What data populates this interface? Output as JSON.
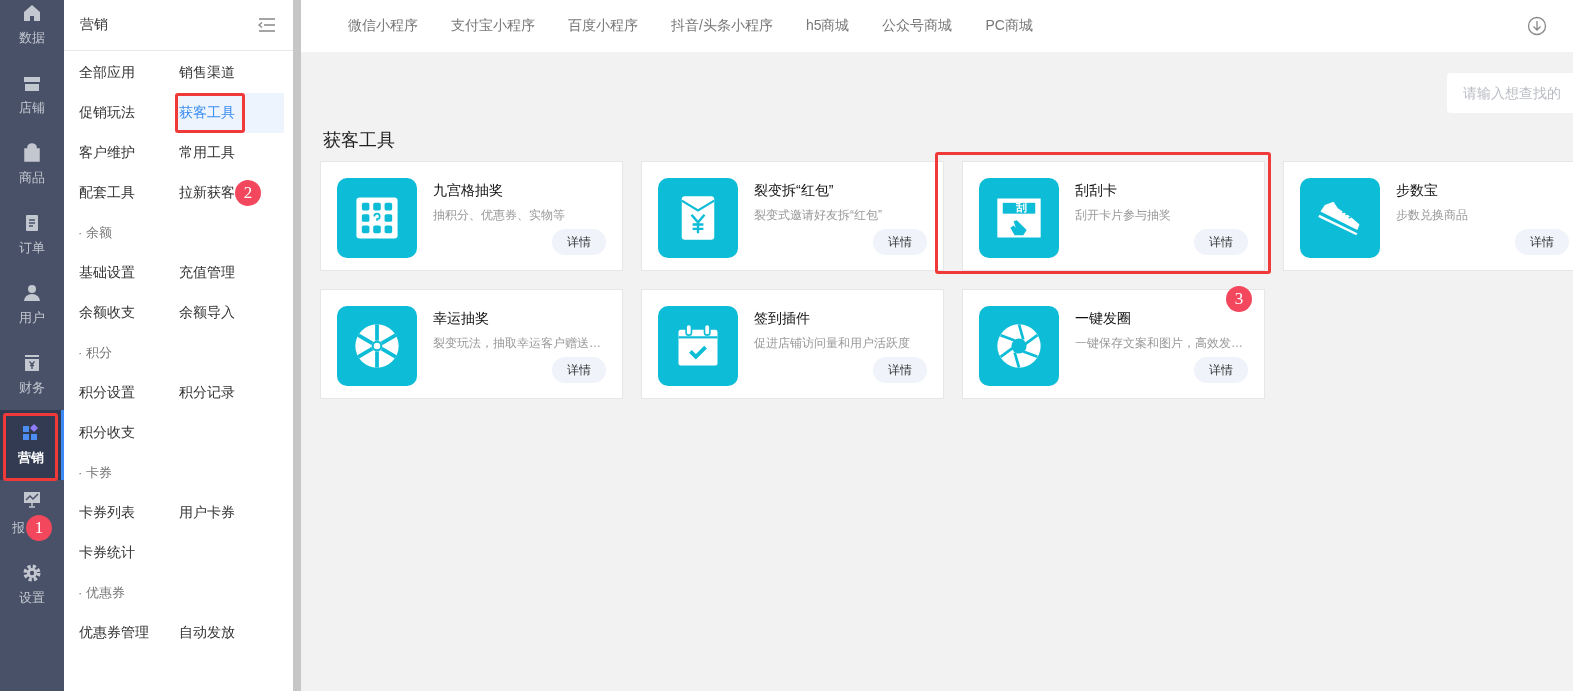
{
  "rail": [
    {
      "label": "数据",
      "selected": false,
      "highlighted": false
    },
    {
      "label": "店铺",
      "selected": false,
      "highlighted": false
    },
    {
      "label": "商品",
      "selected": false,
      "highlighted": false
    },
    {
      "label": "订单",
      "selected": false,
      "highlighted": false
    },
    {
      "label": "用户",
      "selected": false,
      "highlighted": false
    },
    {
      "label": "财务",
      "selected": false,
      "highlighted": false
    },
    {
      "label": "营销",
      "selected": true,
      "highlighted": true
    },
    {
      "label": "报",
      "selected": false,
      "highlighted": false,
      "badge": "1"
    },
    {
      "label": "设置",
      "selected": false,
      "highlighted": false
    }
  ],
  "submenu": {
    "title": "营销",
    "groups": [
      {
        "items": [
          {
            "label": "全部应用",
            "selected": false,
            "highlighted": false
          },
          {
            "label": "销售渠道",
            "selected": false,
            "highlighted": false
          },
          {
            "label": "促销玩法",
            "selected": false,
            "highlighted": false
          },
          {
            "label": "获客工具",
            "selected": true,
            "highlighted": true
          },
          {
            "label": "客户维护",
            "selected": false,
            "highlighted": false
          },
          {
            "label": "常用工具",
            "selected": false,
            "highlighted": false
          },
          {
            "label": "配套工具",
            "selected": false,
            "highlighted": false
          },
          {
            "label": "拉新获客",
            "selected": false,
            "highlighted": false,
            "badge": "2"
          }
        ]
      },
      {
        "heading": "· 余额",
        "items": [
          {
            "label": "基础设置",
            "selected": false,
            "highlighted": false
          },
          {
            "label": "充值管理",
            "selected": false,
            "highlighted": false
          },
          {
            "label": "余额收支",
            "selected": false,
            "highlighted": false
          },
          {
            "label": "余额导入",
            "selected": false,
            "highlighted": false
          }
        ]
      },
      {
        "heading": "· 积分",
        "items": [
          {
            "label": "积分设置",
            "selected": false,
            "highlighted": false
          },
          {
            "label": "积分记录",
            "selected": false,
            "highlighted": false
          },
          {
            "label": "积分收支",
            "selected": false,
            "highlighted": false
          }
        ]
      },
      {
        "heading": "· 卡券",
        "items": [
          {
            "label": "卡券列表",
            "selected": false,
            "highlighted": false
          },
          {
            "label": "用户卡券",
            "selected": false,
            "highlighted": false
          },
          {
            "label": "卡券统计",
            "selected": false,
            "highlighted": false
          }
        ]
      },
      {
        "heading": "· 优惠券",
        "items": [
          {
            "label": "优惠券管理",
            "selected": false,
            "highlighted": false
          },
          {
            "label": "自动发放",
            "selected": false,
            "highlighted": false
          }
        ]
      }
    ]
  },
  "tabs": [
    "微信小程序",
    "支付宝小程序",
    "百度小程序",
    "抖音/头条小程序",
    "h5商城",
    "公众号商城",
    "PC商城"
  ],
  "search": {
    "placeholder": "请输入想查找的"
  },
  "section_title": "获客工具",
  "cards": [
    {
      "title": "九宫格抽奖",
      "description": "抽积分、优惠券、实物等",
      "button": "详情",
      "highlighted": false
    },
    {
      "title": "裂变拆“红包”",
      "description": "裂变式邀请好友拆“红包”",
      "button": "详情",
      "highlighted": false
    },
    {
      "title": "刮刮卡",
      "description": "刮开卡片参与抽奖",
      "button": "详情",
      "highlighted": true,
      "icon_label": "刮"
    },
    {
      "title": "步数宝",
      "description": "步数兑换商品",
      "button": "详情",
      "highlighted": false
    },
    {
      "title": "幸运抽奖",
      "description": "裂变玩法，抽取幸运客户赠送…",
      "button": "详情",
      "highlighted": false
    },
    {
      "title": "签到插件",
      "description": "促进店铺访问量和用户活跃度",
      "button": "详情",
      "highlighted": false
    },
    {
      "title": "一键发圈",
      "description": "一键保存文案和图片，高效发…",
      "button": "详情",
      "highlighted": false,
      "badge": "3"
    }
  ]
}
